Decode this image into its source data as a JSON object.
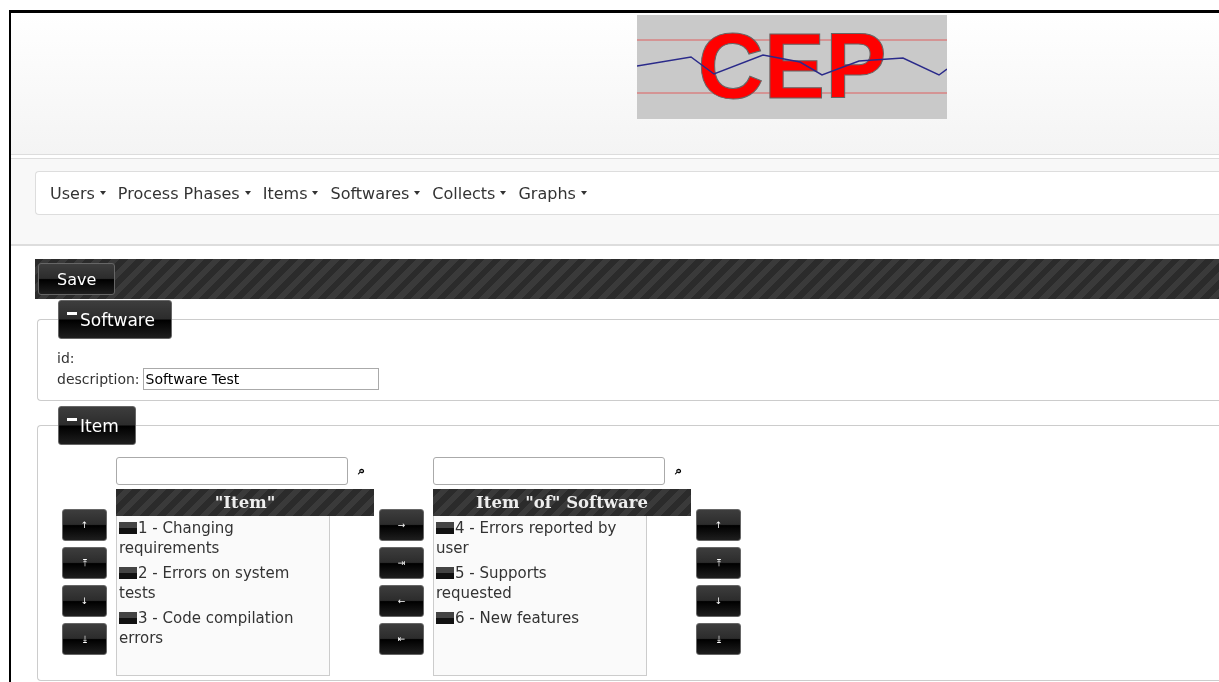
{
  "logo": {
    "text": "CEP"
  },
  "menu": [
    {
      "label": "Users"
    },
    {
      "label": "Process Phases"
    },
    {
      "label": "Items"
    },
    {
      "label": "Softwares"
    },
    {
      "label": "Collects"
    },
    {
      "label": "Graphs"
    }
  ],
  "toolbar": {
    "save": "Save"
  },
  "software_panel": {
    "legend": "Software",
    "expanded": true,
    "id_label": "id:",
    "description_label": "description:",
    "description_value": "Software Test"
  },
  "item_panel": {
    "legend": "Item",
    "expanded": true,
    "source": {
      "header": "\"Item\"",
      "search_icon": "⌕",
      "items": [
        "1 - Changing requirements",
        "2 - Errors on system tests",
        "3 - Code compilation errors"
      ]
    },
    "target": {
      "header": "Item \"of\" Software",
      "search_icon": "⌕",
      "items": [
        "4 - Errors reported by user",
        "5 - Supports requested",
        "6 - New features"
      ]
    },
    "source_buttons": [
      "↑",
      "⤒",
      "↓",
      "⤓"
    ],
    "transfer_buttons": [
      "→",
      "⇥",
      "←",
      "⇤"
    ],
    "target_buttons": [
      "↑",
      "⤒",
      "↓",
      "⤓"
    ]
  }
}
